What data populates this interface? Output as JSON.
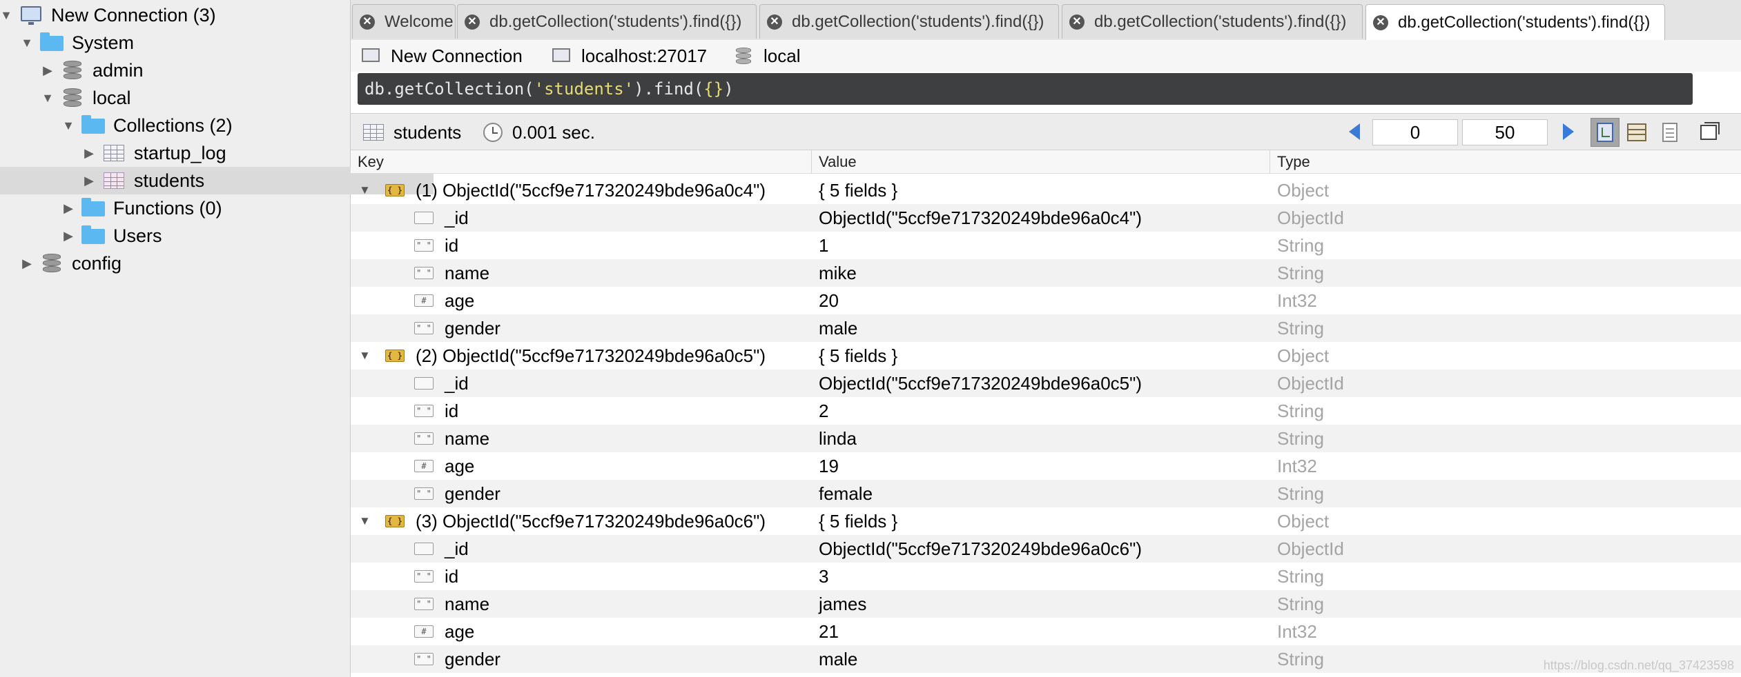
{
  "sidebar": {
    "connection": "New Connection (3)",
    "system": "System",
    "admin": "admin",
    "local": "local",
    "collections": "Collections (2)",
    "startup_log": "startup_log",
    "students": "students",
    "functions": "Functions (0)",
    "users": "Users",
    "config": "config"
  },
  "tabs": [
    {
      "label": "Welcome"
    },
    {
      "label": "db.getCollection('students').find({})"
    },
    {
      "label": "db.getCollection('students').find({})"
    },
    {
      "label": "db.getCollection('students').find({})"
    },
    {
      "label": "db.getCollection('students').find({})"
    }
  ],
  "connection": {
    "name": "New Connection",
    "host": "localhost:27017",
    "database": "local"
  },
  "query": {
    "prefix": "db.getCollection(",
    "string": "'students'",
    "middle": ").find(",
    "braces": "{}",
    "suffix": ")"
  },
  "results": {
    "collection": "students",
    "time": "0.001 sec.",
    "skip": "0",
    "limit": "50"
  },
  "columns": {
    "key": "Key",
    "value": "Value",
    "type": "Type"
  },
  "rows": [
    {
      "key": "(1) ObjectId(\"5ccf9e717320249bde96a0c4\")",
      "value": "{ 5 fields }",
      "type": "Object"
    },
    {
      "key": "_id",
      "value": "ObjectId(\"5ccf9e717320249bde96a0c4\")",
      "type": "ObjectId"
    },
    {
      "key": "id",
      "value": "1",
      "type": "String"
    },
    {
      "key": "name",
      "value": "mike",
      "type": "String"
    },
    {
      "key": "age",
      "value": "20",
      "type": "Int32"
    },
    {
      "key": "gender",
      "value": "male",
      "type": "String"
    },
    {
      "key": "(2) ObjectId(\"5ccf9e717320249bde96a0c5\")",
      "value": "{ 5 fields }",
      "type": "Object"
    },
    {
      "key": "_id",
      "value": "ObjectId(\"5ccf9e717320249bde96a0c5\")",
      "type": "ObjectId"
    },
    {
      "key": "id",
      "value": "2",
      "type": "String"
    },
    {
      "key": "name",
      "value": "linda",
      "type": "String"
    },
    {
      "key": "age",
      "value": "19",
      "type": "Int32"
    },
    {
      "key": "gender",
      "value": "female",
      "type": "String"
    },
    {
      "key": "(3) ObjectId(\"5ccf9e717320249bde96a0c6\")",
      "value": "{ 5 fields }",
      "type": "Object"
    },
    {
      "key": "_id",
      "value": "ObjectId(\"5ccf9e717320249bde96a0c6\")",
      "type": "ObjectId"
    },
    {
      "key": "id",
      "value": "3",
      "type": "String"
    },
    {
      "key": "name",
      "value": "james",
      "type": "String"
    },
    {
      "key": "age",
      "value": "21",
      "type": "Int32"
    },
    {
      "key": "gender",
      "value": "male",
      "type": "String"
    }
  ],
  "icons": {
    "object": "object-icon",
    "objectid": "objectid-icon",
    "string": "string-icon",
    "number": "number-icon"
  },
  "colors": {
    "query_bg": "#3d3f41",
    "query_string": "#e6db74",
    "pager_arrow": "#3a7bd5",
    "type_text": "#a4a4a4"
  },
  "watermark": "https://blog.csdn.net/qq_37423598"
}
